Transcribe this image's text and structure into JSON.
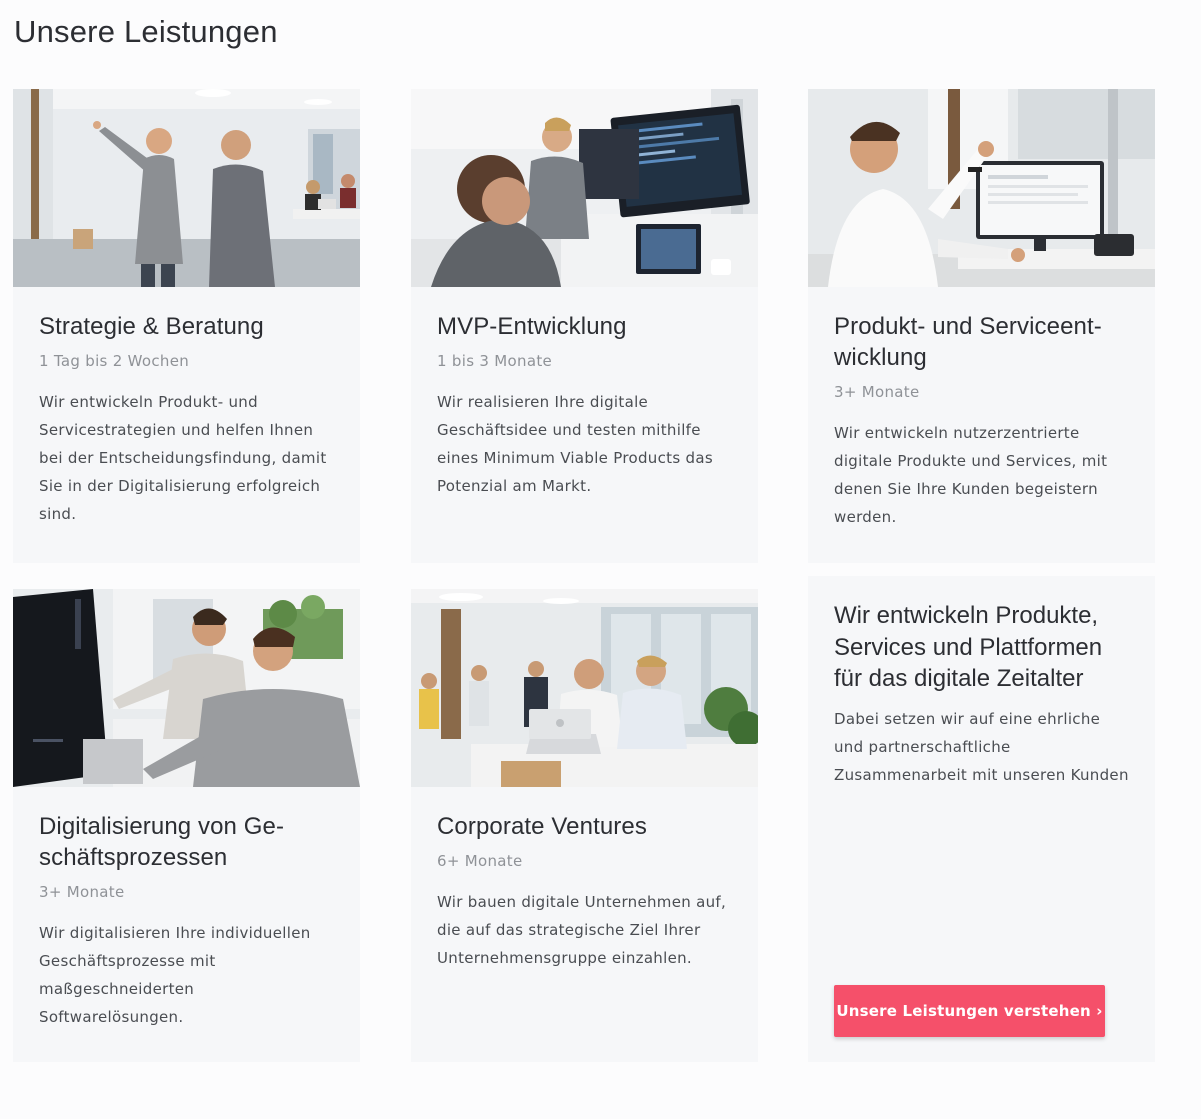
{
  "page": {
    "title": "Unsere Leistungen"
  },
  "services": [
    {
      "title": "Strategie & Beratung",
      "duration": "1 Tag bis 2 Wochen",
      "description": "Wir entwickeln Produkt- und Servicestrategien und helfen Ihnen bei der Entscheidungsfindung, damit Sie in der Digitalisierung erfolgreich sind."
    },
    {
      "title": "MVP-Entwicklung",
      "duration": "1 bis 3 Monate",
      "description": "Wir realisieren Ihre digitale Geschäftsidee und testen mithilfe eines Minimum Viable Products das Potenzial am Markt."
    },
    {
      "title": "Produkt- und Serviceent­wicklung",
      "duration": "3+ Monate",
      "description": "Wir entwickeln nutzerzentrierte digitale Produkte und Services, mit denen Sie Ihre Kunden begeistern werden."
    },
    {
      "title": "Digitalisierung von Ge­schäftsprozessen",
      "duration": "3+ Monate",
      "description": "Wir digitalisieren Ihre individuellen Geschäftsprozesse mit maßgeschneiderten Softwarelösungen."
    },
    {
      "title": "Corporate Ventures",
      "duration": "6+ Monate",
      "description": "Wir bauen digitale Unternehmen auf, die auf das strategische Ziel Ihrer Unternehmensgruppe einzahlen."
    }
  ],
  "info": {
    "heading": "Wir entwickeln Produkte, Services und Plattformen für das digitale Zeitalter",
    "text": "Dabei setzen wir auf eine ehrliche und partnerschaftliche Zusammenarbeit mit unseren Kunden",
    "button_label": "Unsere Leistungen verstehen ›"
  },
  "colors": {
    "accent": "#f5506a",
    "card_bg": "#f6f7f9",
    "muted": "#8f9297"
  }
}
